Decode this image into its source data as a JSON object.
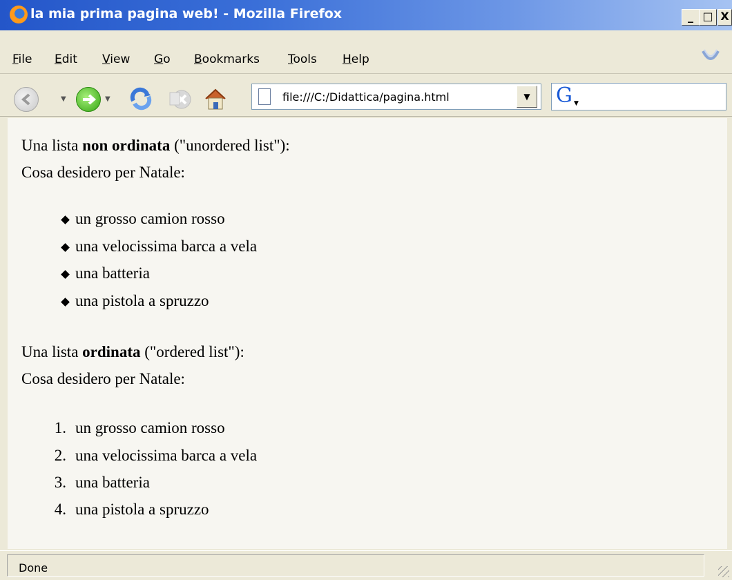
{
  "window": {
    "title": "la mia prima pagina web! - Mozilla Firefox",
    "controls": {
      "minimize": "_",
      "maximize": "□",
      "close": "X"
    }
  },
  "menubar": {
    "items": [
      {
        "label": "File",
        "accel": "F",
        "rest": "ile"
      },
      {
        "label": "Edit",
        "accel": "E",
        "rest": "dit"
      },
      {
        "label": "View",
        "accel": "V",
        "rest": "iew"
      },
      {
        "label": "Go",
        "accel": "G",
        "rest": "o"
      },
      {
        "label": "Bookmarks",
        "accel": "B",
        "rest": "ookmarks"
      },
      {
        "label": "Tools",
        "accel": "T",
        "rest": "ools"
      },
      {
        "label": "Help",
        "accel": "H",
        "rest": "elp"
      }
    ]
  },
  "toolbar": {
    "icons": [
      "back-icon",
      "forward-icon",
      "reload-icon",
      "stop-icon",
      "home-icon"
    ],
    "url": "file:///C:/Didattica/pagina.html",
    "search_engine_icon": "G"
  },
  "page": {
    "unordered": {
      "intro_prefix": "Una lista ",
      "intro_bold": "non ordinata",
      "intro_suffix": " (\"unordered list\"):",
      "heading": "Cosa desidero per Natale:",
      "items": [
        "un grosso camion rosso",
        "una velocissima barca a vela",
        "una batteria",
        "una pistola a spruzzo"
      ]
    },
    "ordered": {
      "intro_prefix": "Una lista ",
      "intro_bold": "ordinata",
      "intro_suffix": " (\"ordered list\"):",
      "heading": "Cosa desidero per Natale:",
      "numbers": [
        "1.",
        "2.",
        "3.",
        "4."
      ],
      "items": [
        "un grosso camion rosso",
        "una velocissima barca a vela",
        "una batteria",
        "una pistola a spruzzo"
      ]
    }
  },
  "statusbar": {
    "text": "Done"
  },
  "colors": {
    "titlebar": "#2456c9",
    "chrome": "#ece9d8",
    "content_bg": "#f7f6f1"
  }
}
